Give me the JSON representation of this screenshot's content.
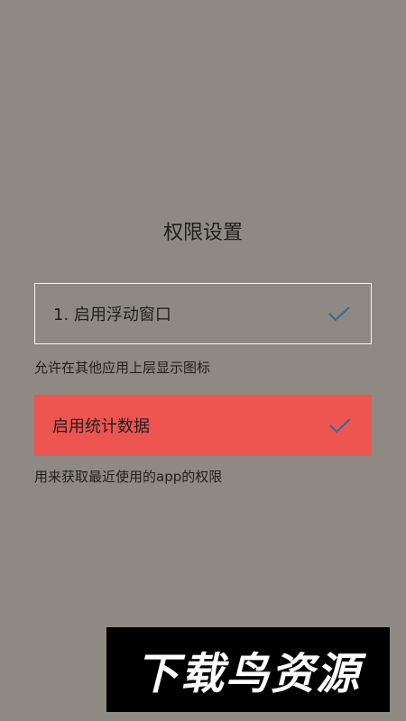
{
  "page": {
    "title": "权限设置",
    "background_color": "#8e8a83"
  },
  "permissions": [
    {
      "label": "1. 启用浮动窗口",
      "description": "允许在其他应用上层显示图标",
      "status_icon": "check-icon",
      "enabled": true
    },
    {
      "label": "启用统计数据",
      "description": "用来获取最近使用的app的权限",
      "status_icon": "check-icon",
      "enabled": true,
      "highlight_color": "#ee5450"
    }
  ],
  "watermark": {
    "text": "下载鸟资源"
  }
}
